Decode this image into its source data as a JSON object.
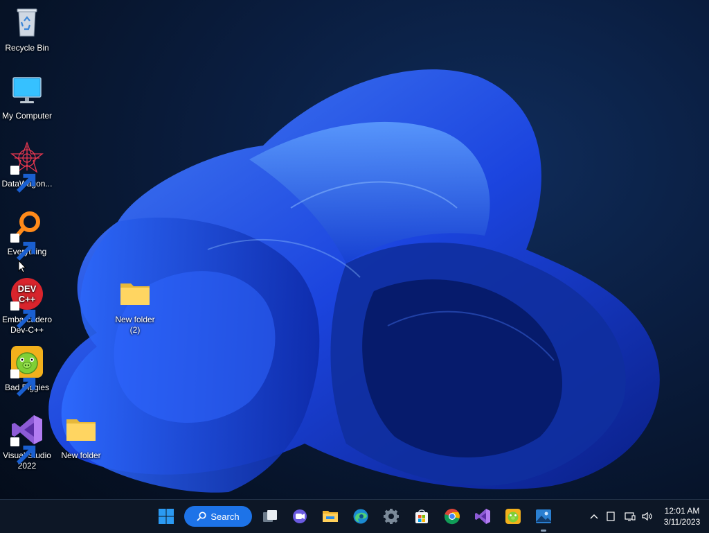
{
  "desktop": {
    "icons": [
      {
        "name": "Recycle Bin"
      },
      {
        "name": "My Computer"
      },
      {
        "name": "DataWagon..."
      },
      {
        "name": "Everything"
      },
      {
        "name": "Embarcadero Dev-C++"
      },
      {
        "name": "Bad Piggies"
      },
      {
        "name": "Visual Studio 2022"
      },
      {
        "name": "New folder (2)"
      },
      {
        "name": "New folder"
      }
    ],
    "wallpaper_accent": "#1f4fff"
  },
  "taskbar": {
    "search_label": "Search",
    "pinned": [
      "start-icon",
      "task-view-icon",
      "chat-icon",
      "file-explorer-icon",
      "edge-icon",
      "settings-icon",
      "store-icon",
      "chrome-icon",
      "visual-studio-icon",
      "bad-piggies-icon",
      "photos-icon"
    ],
    "clock": {
      "time": "12:01 AM",
      "date": "3/11/2023"
    }
  }
}
